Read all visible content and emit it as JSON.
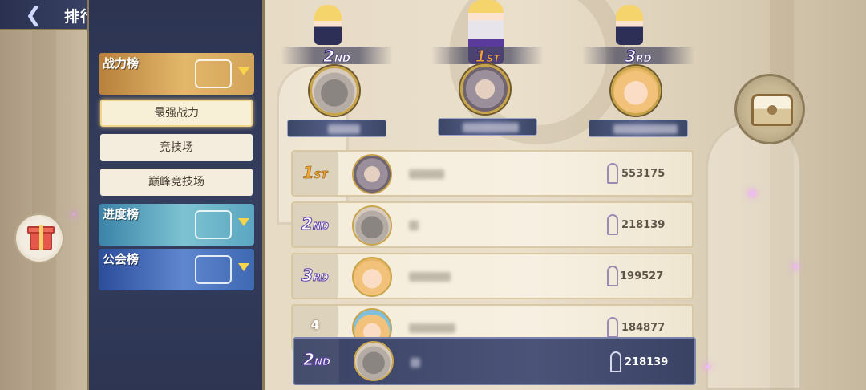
{
  "header": {
    "title": "排行榜",
    "back_icon": "back-arrow-icon"
  },
  "sidebar": {
    "categories": [
      {
        "label": "战力榜",
        "emblem": "power-emblem-icon",
        "color": "#d2a459"
      },
      {
        "label": "进度榜",
        "emblem": "progress-emblem-icon",
        "color": "#5aa6c1"
      },
      {
        "label": "公会榜",
        "emblem": "guild-emblem-icon",
        "color": "#3f68b3"
      }
    ],
    "sub_items": [
      {
        "label": "最强战力",
        "active": true
      },
      {
        "label": "竞技场",
        "active": false
      },
      {
        "label": "巅峰竞技场",
        "active": false
      }
    ]
  },
  "podium": [
    {
      "rank": "2",
      "suffix": "ND",
      "avatar": "bear-avatar"
    },
    {
      "rank": "1",
      "suffix": "ST",
      "avatar": "silver-hair-man-avatar"
    },
    {
      "rank": "3",
      "suffix": "RD",
      "avatar": "blonde-girl-avatar"
    }
  ],
  "list": [
    {
      "rank": "1",
      "suffix": "ST",
      "avatar": "silver-hair-man-avatar",
      "power": "553175"
    },
    {
      "rank": "2",
      "suffix": "ND",
      "avatar": "bear-avatar",
      "power": "218139"
    },
    {
      "rank": "3",
      "suffix": "RD",
      "avatar": "blonde-girl-avatar",
      "power": "199527"
    },
    {
      "rank": "4",
      "suffix": "",
      "avatar": "hat-girl-avatar",
      "power": "184877"
    }
  ],
  "self_row": {
    "rank": "2",
    "suffix": "ND",
    "avatar": "bear-avatar",
    "power": "218139"
  },
  "buttons": {
    "gift": "gift-icon",
    "chest": "treasure-chest-icon"
  }
}
